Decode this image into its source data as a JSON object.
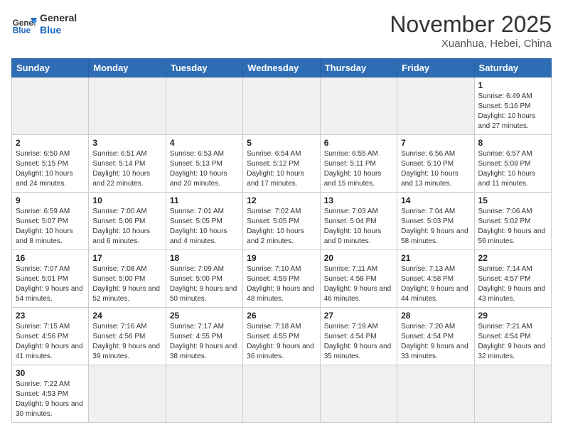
{
  "header": {
    "logo_general": "General",
    "logo_blue": "Blue",
    "month_title": "November 2025",
    "location": "Xuanhua, Hebei, China"
  },
  "weekdays": [
    "Sunday",
    "Monday",
    "Tuesday",
    "Wednesday",
    "Thursday",
    "Friday",
    "Saturday"
  ],
  "days": [
    {
      "num": "",
      "empty": true
    },
    {
      "num": "",
      "empty": true
    },
    {
      "num": "",
      "empty": true
    },
    {
      "num": "",
      "empty": true
    },
    {
      "num": "",
      "empty": true
    },
    {
      "num": "",
      "empty": true
    },
    {
      "num": "1",
      "sunrise": "6:49 AM",
      "sunset": "5:16 PM",
      "daylight": "10 hours and 27 minutes."
    },
    {
      "num": "2",
      "sunrise": "6:50 AM",
      "sunset": "5:15 PM",
      "daylight": "10 hours and 24 minutes."
    },
    {
      "num": "3",
      "sunrise": "6:51 AM",
      "sunset": "5:14 PM",
      "daylight": "10 hours and 22 minutes."
    },
    {
      "num": "4",
      "sunrise": "6:53 AM",
      "sunset": "5:13 PM",
      "daylight": "10 hours and 20 minutes."
    },
    {
      "num": "5",
      "sunrise": "6:54 AM",
      "sunset": "5:12 PM",
      "daylight": "10 hours and 17 minutes."
    },
    {
      "num": "6",
      "sunrise": "6:55 AM",
      "sunset": "5:11 PM",
      "daylight": "10 hours and 15 minutes."
    },
    {
      "num": "7",
      "sunrise": "6:56 AM",
      "sunset": "5:10 PM",
      "daylight": "10 hours and 13 minutes."
    },
    {
      "num": "8",
      "sunrise": "6:57 AM",
      "sunset": "5:08 PM",
      "daylight": "10 hours and 11 minutes."
    },
    {
      "num": "9",
      "sunrise": "6:59 AM",
      "sunset": "5:07 PM",
      "daylight": "10 hours and 8 minutes."
    },
    {
      "num": "10",
      "sunrise": "7:00 AM",
      "sunset": "5:06 PM",
      "daylight": "10 hours and 6 minutes."
    },
    {
      "num": "11",
      "sunrise": "7:01 AM",
      "sunset": "5:05 PM",
      "daylight": "10 hours and 4 minutes."
    },
    {
      "num": "12",
      "sunrise": "7:02 AM",
      "sunset": "5:05 PM",
      "daylight": "10 hours and 2 minutes."
    },
    {
      "num": "13",
      "sunrise": "7:03 AM",
      "sunset": "5:04 PM",
      "daylight": "10 hours and 0 minutes."
    },
    {
      "num": "14",
      "sunrise": "7:04 AM",
      "sunset": "5:03 PM",
      "daylight": "9 hours and 58 minutes."
    },
    {
      "num": "15",
      "sunrise": "7:06 AM",
      "sunset": "5:02 PM",
      "daylight": "9 hours and 56 minutes."
    },
    {
      "num": "16",
      "sunrise": "7:07 AM",
      "sunset": "5:01 PM",
      "daylight": "9 hours and 54 minutes."
    },
    {
      "num": "17",
      "sunrise": "7:08 AM",
      "sunset": "5:00 PM",
      "daylight": "9 hours and 52 minutes."
    },
    {
      "num": "18",
      "sunrise": "7:09 AM",
      "sunset": "5:00 PM",
      "daylight": "9 hours and 50 minutes."
    },
    {
      "num": "19",
      "sunrise": "7:10 AM",
      "sunset": "4:59 PM",
      "daylight": "9 hours and 48 minutes."
    },
    {
      "num": "20",
      "sunrise": "7:11 AM",
      "sunset": "4:58 PM",
      "daylight": "9 hours and 46 minutes."
    },
    {
      "num": "21",
      "sunrise": "7:13 AM",
      "sunset": "4:58 PM",
      "daylight": "9 hours and 44 minutes."
    },
    {
      "num": "22",
      "sunrise": "7:14 AM",
      "sunset": "4:57 PM",
      "daylight": "9 hours and 43 minutes."
    },
    {
      "num": "23",
      "sunrise": "7:15 AM",
      "sunset": "4:56 PM",
      "daylight": "9 hours and 41 minutes."
    },
    {
      "num": "24",
      "sunrise": "7:16 AM",
      "sunset": "4:56 PM",
      "daylight": "9 hours and 39 minutes."
    },
    {
      "num": "25",
      "sunrise": "7:17 AM",
      "sunset": "4:55 PM",
      "daylight": "9 hours and 38 minutes."
    },
    {
      "num": "26",
      "sunrise": "7:18 AM",
      "sunset": "4:55 PM",
      "daylight": "9 hours and 36 minutes."
    },
    {
      "num": "27",
      "sunrise": "7:19 AM",
      "sunset": "4:54 PM",
      "daylight": "9 hours and 35 minutes."
    },
    {
      "num": "28",
      "sunrise": "7:20 AM",
      "sunset": "4:54 PM",
      "daylight": "9 hours and 33 minutes."
    },
    {
      "num": "29",
      "sunrise": "7:21 AM",
      "sunset": "4:54 PM",
      "daylight": "9 hours and 32 minutes."
    },
    {
      "num": "30",
      "sunrise": "7:22 AM",
      "sunset": "4:53 PM",
      "daylight": "9 hours and 30 minutes."
    }
  ],
  "labels": {
    "sunrise": "Sunrise:",
    "sunset": "Sunset:",
    "daylight": "Daylight:"
  }
}
